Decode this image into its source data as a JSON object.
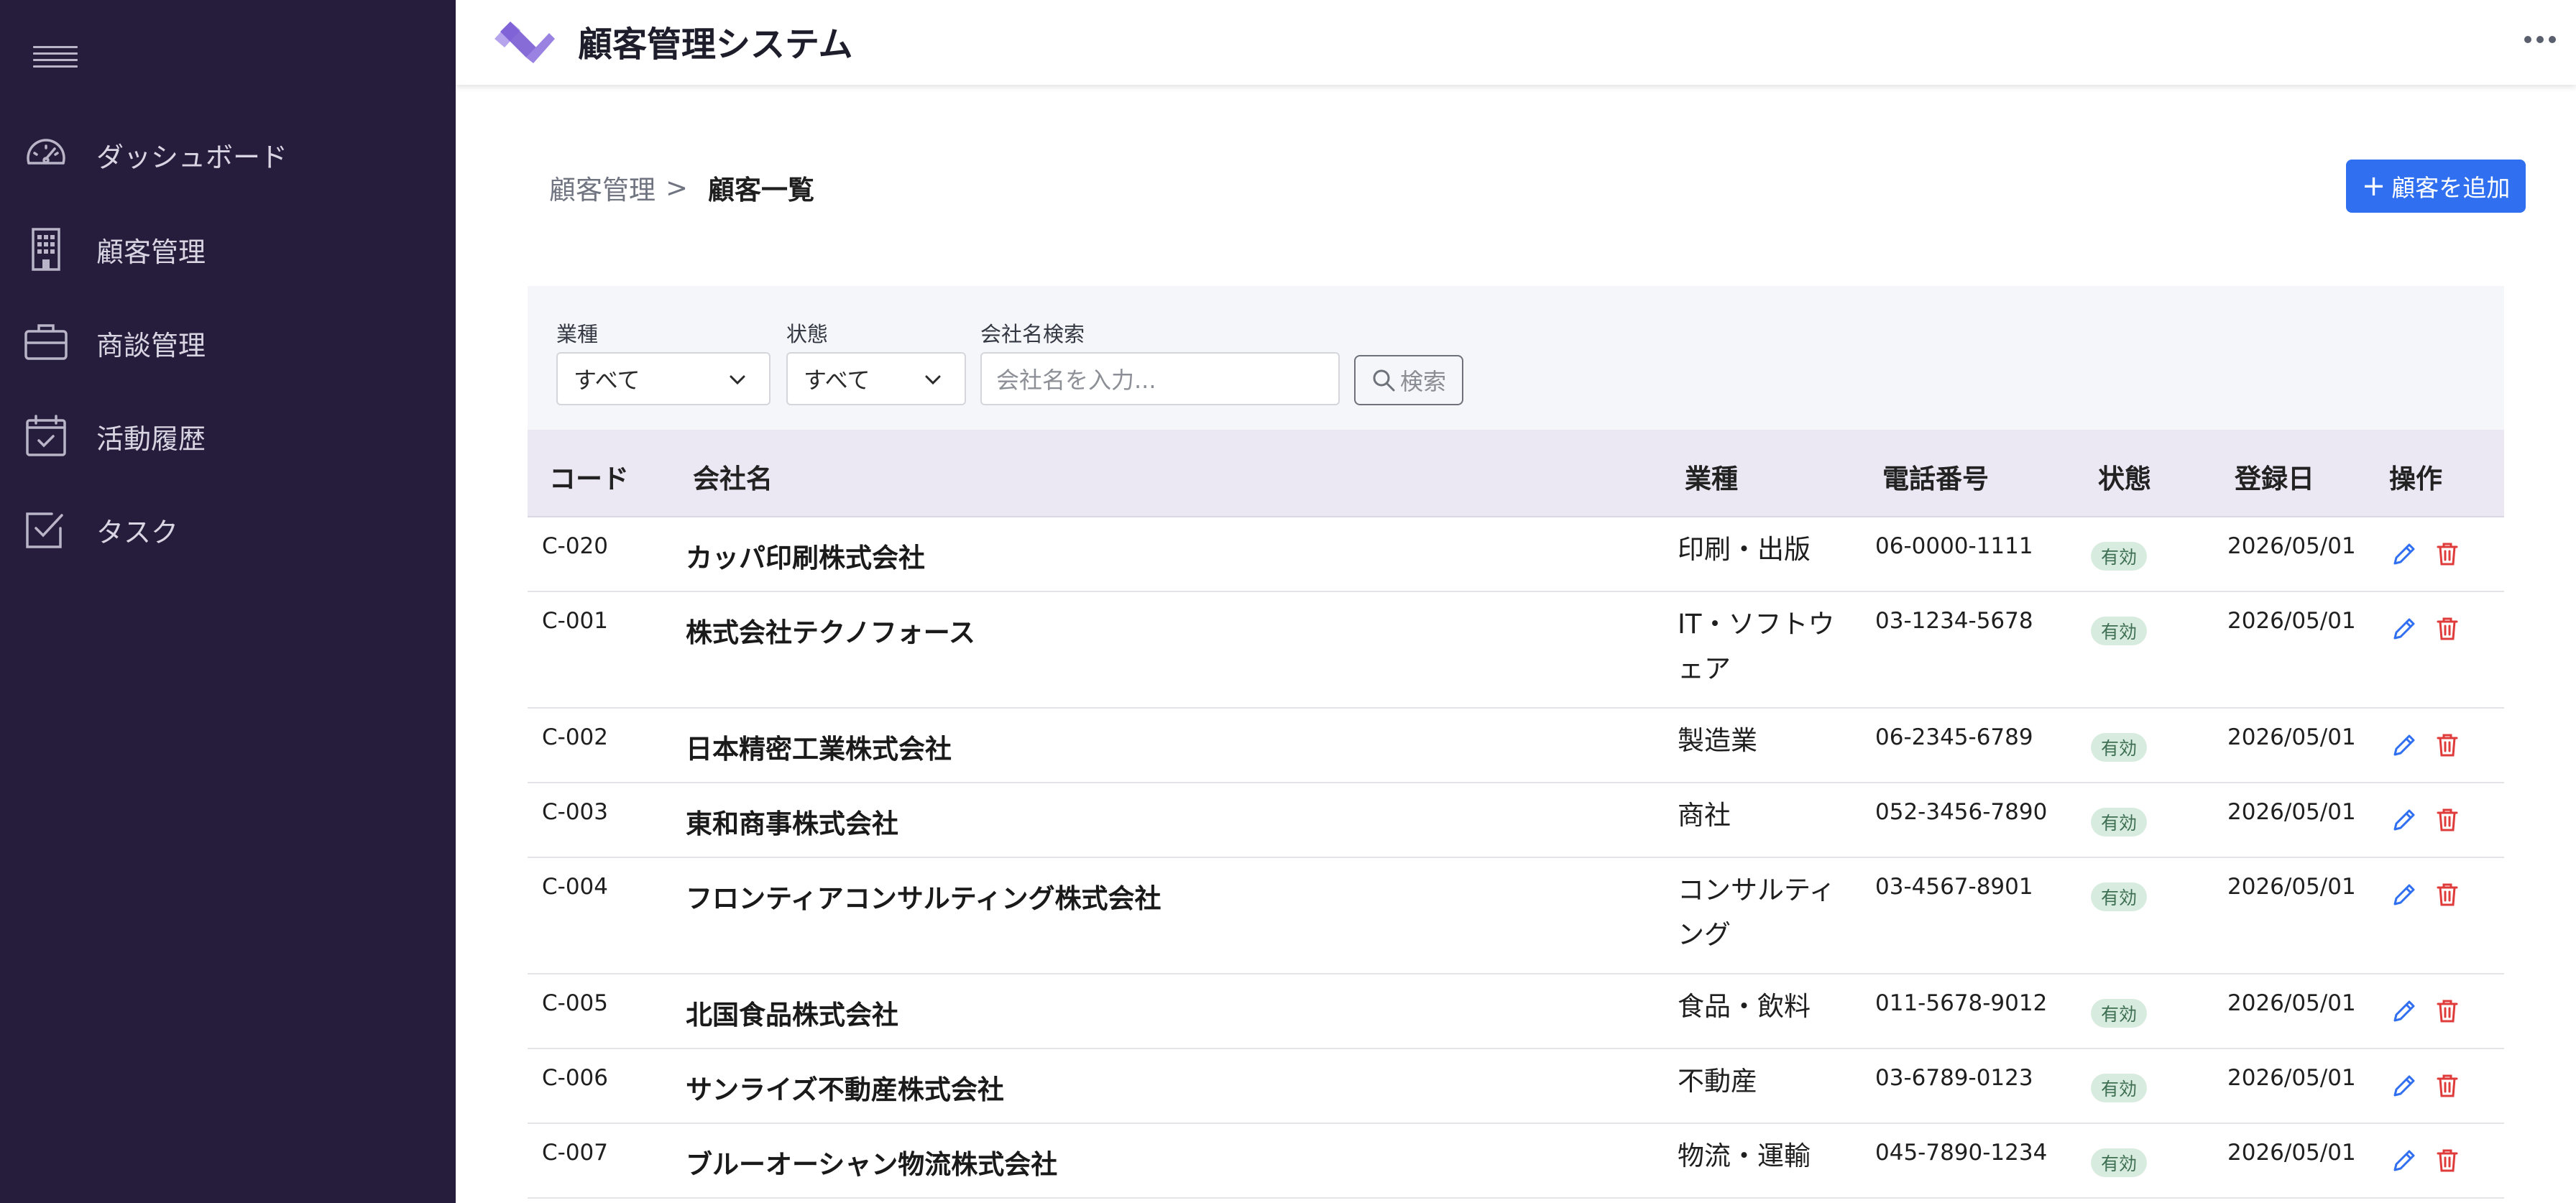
{
  "app": {
    "title": "顧客管理システム"
  },
  "colors": {
    "sidebar": "#261d3c",
    "accent": "#2f6ff0",
    "logo": "#8a6fd6",
    "status_badge": "#d7ecdf",
    "edit_icon": "#2f6ff0",
    "delete_icon": "#e03b3b"
  },
  "sidebar": {
    "items": [
      {
        "label": "ダッシュボード",
        "icon": "speedometer-icon"
      },
      {
        "label": "顧客管理",
        "icon": "building-icon"
      },
      {
        "label": "商談管理",
        "icon": "briefcase-icon"
      },
      {
        "label": "活動履歴",
        "icon": "calendar-check-icon"
      },
      {
        "label": "タスク",
        "icon": "checkbox-icon"
      }
    ]
  },
  "breadcrumb": {
    "parent": "顧客管理",
    "separator": ">",
    "current": "顧客一覧"
  },
  "actions": {
    "add_customer": "顧客を追加"
  },
  "filters": {
    "industry": {
      "label": "業種",
      "value": "すべて"
    },
    "status": {
      "label": "状態",
      "value": "すべて"
    },
    "company_search": {
      "label": "会社名検索",
      "placeholder": "会社名を入力..."
    },
    "search_button": "検索"
  },
  "table": {
    "headers": {
      "code": "コード",
      "name": "会社名",
      "industry": "業種",
      "phone": "電話番号",
      "status": "状態",
      "registered": "登録日",
      "actions": "操作"
    },
    "rows": [
      {
        "code": "C-020",
        "name": "カッパ印刷株式会社",
        "industry": "印刷・出版",
        "phone": "06-0000-1111",
        "status": "有効",
        "date": "2026/05/01"
      },
      {
        "code": "C-001",
        "name": "株式会社テクノフォース",
        "industry": "IT・ソフトウェア",
        "phone": "03-1234-5678",
        "status": "有効",
        "date": "2026/05/01"
      },
      {
        "code": "C-002",
        "name": "日本精密工業株式会社",
        "industry": "製造業",
        "phone": "06-2345-6789",
        "status": "有効",
        "date": "2026/05/01"
      },
      {
        "code": "C-003",
        "name": "東和商事株式会社",
        "industry": "商社",
        "phone": "052-3456-7890",
        "status": "有効",
        "date": "2026/05/01"
      },
      {
        "code": "C-004",
        "name": "フロンティアコンサルティング株式会社",
        "industry": "コンサルティング",
        "phone": "03-4567-8901",
        "status": "有効",
        "date": "2026/05/01"
      },
      {
        "code": "C-005",
        "name": "北国食品株式会社",
        "industry": "食品・飲料",
        "phone": "011-5678-9012",
        "status": "有効",
        "date": "2026/05/01"
      },
      {
        "code": "C-006",
        "name": "サンライズ不動産株式会社",
        "industry": "不動産",
        "phone": "03-6789-0123",
        "status": "有効",
        "date": "2026/05/01"
      },
      {
        "code": "C-007",
        "name": "ブルーオーシャン物流株式会社",
        "industry": "物流・運輸",
        "phone": "045-7890-1234",
        "status": "有効",
        "date": "2026/05/01"
      }
    ]
  }
}
